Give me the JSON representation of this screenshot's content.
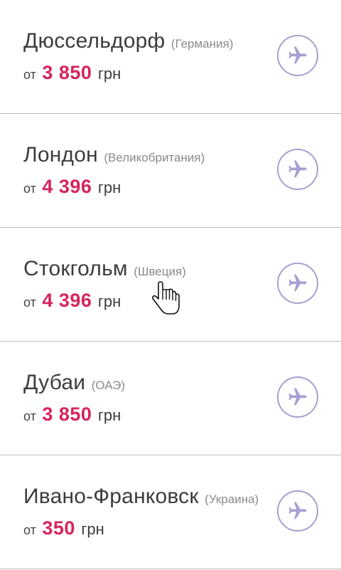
{
  "colors": {
    "accent": "#d6255c",
    "icon": "#a79fd1",
    "divider": "#bdbdbd"
  },
  "destinations": [
    {
      "city": "Дюссельдорф",
      "country": "(Германия)",
      "from": "от",
      "price": "3 850",
      "currency": "грн",
      "icon": "airplane-icon"
    },
    {
      "city": "Лондон",
      "country": "(Великобритания)",
      "from": "от",
      "price": "4 396",
      "currency": "грн",
      "icon": "airplane-icon"
    },
    {
      "city": "Стокгольм",
      "country": "(Швеция)",
      "from": "от",
      "price": "4 396",
      "currency": "грн",
      "icon": "airplane-icon"
    },
    {
      "city": "Дубаи",
      "country": "(ОАЭ)",
      "from": "от",
      "price": "3 850",
      "currency": "грн",
      "icon": "airplane-icon"
    },
    {
      "city": "Ивано-Франковск",
      "country": "(Украина)",
      "from": "от",
      "price": "350",
      "currency": "грн",
      "icon": "airplane-icon"
    }
  ],
  "cursor": {
    "icon": "hand-pointer-icon"
  }
}
